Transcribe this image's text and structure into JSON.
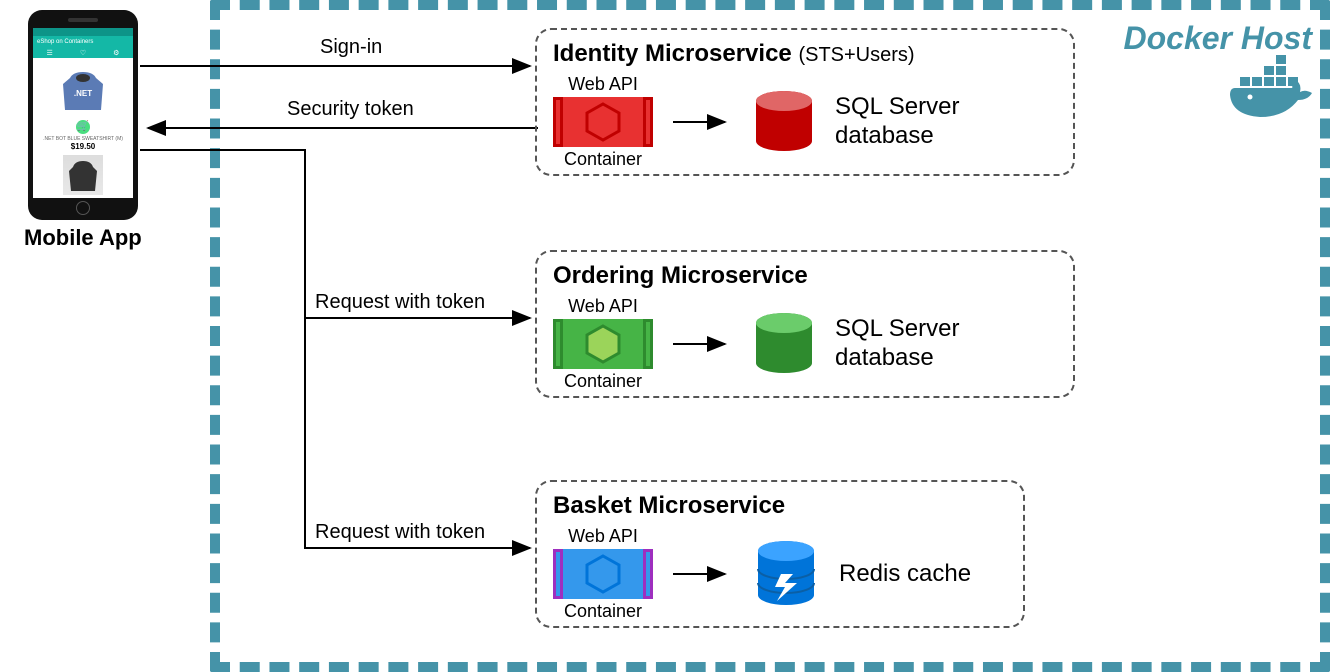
{
  "docker": {
    "host_label": "Docker Host"
  },
  "mobile": {
    "label": "Mobile App",
    "app_title": "eShop on Containers",
    "product_name": ".NET BOT BLUE SWEATSHIRT (M)",
    "price": "$19.50"
  },
  "arrows": {
    "signin": "Sign-in",
    "security_token": "Security token",
    "request_with_token_1": "Request with token",
    "request_with_token_2": "Request with token"
  },
  "microservices": {
    "identity": {
      "title": "Identity Microservice",
      "subtitle": "(STS+Users)",
      "webapi": "Web API",
      "container": "Container",
      "db_label": "SQL Server database",
      "color": "red"
    },
    "ordering": {
      "title": "Ordering Microservice",
      "webapi": "Web API",
      "container": "Container",
      "db_label": "SQL Server database",
      "color": "green"
    },
    "basket": {
      "title": "Basket Microservice",
      "webapi": "Web API",
      "container": "Container",
      "db_label": "Redis cache",
      "color": "blue"
    }
  }
}
